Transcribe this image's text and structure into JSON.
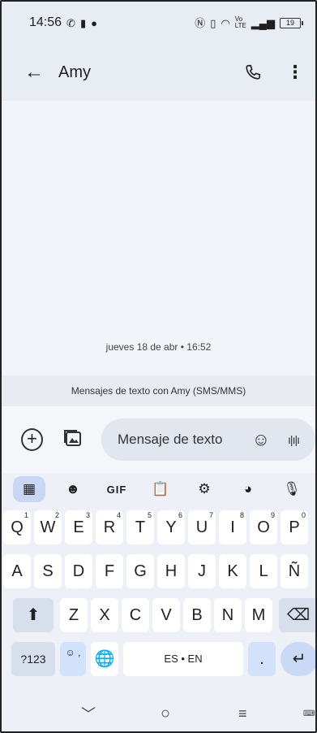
{
  "status_bar": {
    "time": "14:56",
    "lte_label": "Vo LTE",
    "battery_level": "19"
  },
  "app_bar": {
    "back_icon": "arrow-back-icon",
    "title": "Amy",
    "call_icon": "phone-icon",
    "more_icon": "more-vert-icon"
  },
  "conversation": {
    "timestamp": "jueves 18 de abr • 16:52",
    "info_banner": "Mensajes de texto con Amy (SMS/MMS)"
  },
  "composer": {
    "placeholder": "Mensaje de texto"
  },
  "keyboard": {
    "toolbar": {
      "gif_label": "GIF"
    },
    "row1": [
      {
        "label": "Q",
        "hint": "1"
      },
      {
        "label": "W",
        "hint": "2"
      },
      {
        "label": "E",
        "hint": "3"
      },
      {
        "label": "R",
        "hint": "4"
      },
      {
        "label": "T",
        "hint": "5"
      },
      {
        "label": "Y",
        "hint": "6"
      },
      {
        "label": "U",
        "hint": "7"
      },
      {
        "label": "I",
        "hint": "8"
      },
      {
        "label": "O",
        "hint": "9"
      },
      {
        "label": "P",
        "hint": "0"
      }
    ],
    "row2": [
      "A",
      "S",
      "D",
      "F",
      "G",
      "H",
      "J",
      "K",
      "L",
      "Ñ"
    ],
    "row3": [
      "Z",
      "X",
      "C",
      "V",
      "B",
      "N",
      "M"
    ],
    "symbols_label": "?123",
    "emoji_key_label": "☺ ,",
    "space_label": "ES • EN",
    "period_label": "."
  }
}
